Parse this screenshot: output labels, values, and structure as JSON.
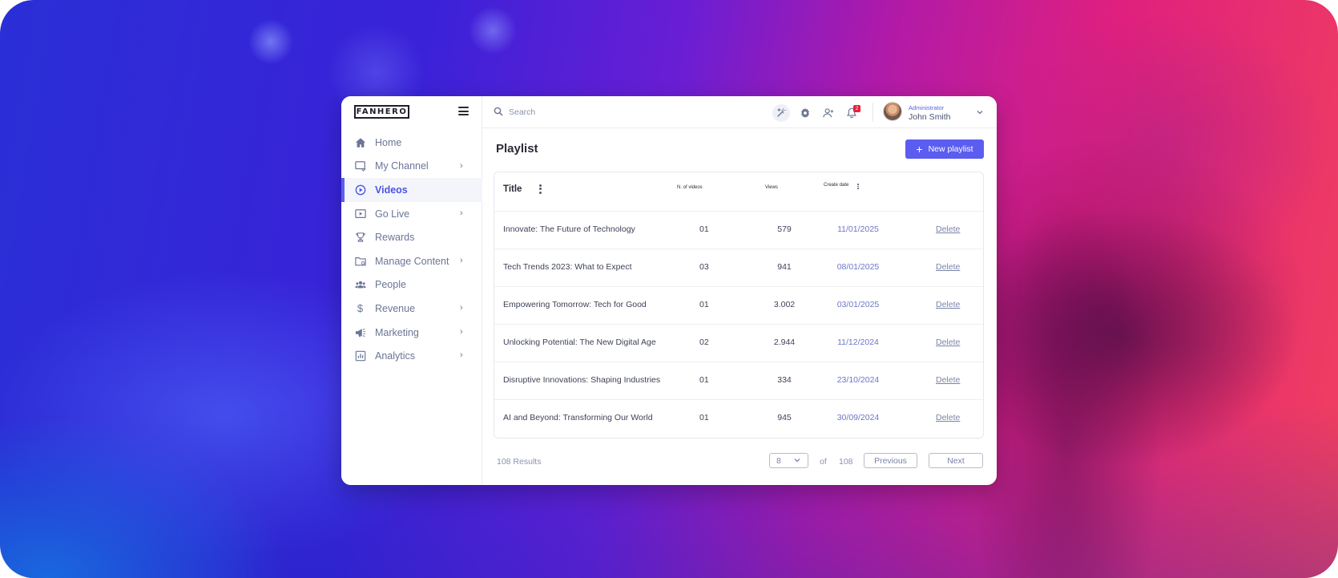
{
  "brand": {
    "logo_text": "FANHERO"
  },
  "sidebar": {
    "items": [
      {
        "label": "Home",
        "icon": "home-icon",
        "has_chevron": false,
        "active": false
      },
      {
        "label": "My Channel",
        "icon": "channel-icon",
        "has_chevron": true,
        "active": false
      },
      {
        "label": "Videos",
        "icon": "play-circle-icon",
        "has_chevron": false,
        "active": true
      },
      {
        "label": "Go Live",
        "icon": "live-icon",
        "has_chevron": true,
        "active": false
      },
      {
        "label": "Rewards",
        "icon": "trophy-icon",
        "has_chevron": false,
        "active": false
      },
      {
        "label": "Manage Content",
        "icon": "folder-icon",
        "has_chevron": true,
        "active": false
      },
      {
        "label": "People",
        "icon": "people-icon",
        "has_chevron": false,
        "active": false
      },
      {
        "label": "Revenue",
        "icon": "dollar-icon",
        "has_chevron": true,
        "active": false
      },
      {
        "label": "Marketing",
        "icon": "megaphone-icon",
        "has_chevron": true,
        "active": false
      },
      {
        "label": "Analytics",
        "icon": "analytics-icon",
        "has_chevron": true,
        "active": false
      }
    ]
  },
  "topbar": {
    "search_placeholder": "Search",
    "notification_count": "2",
    "user": {
      "role": "Administrator",
      "name": "John Smith"
    }
  },
  "main": {
    "title": "Playlist",
    "new_button": "New playlist",
    "table": {
      "headers": {
        "title": "Title",
        "videos": "N. of videos",
        "views": "Views",
        "date": "Create date"
      },
      "rows": [
        {
          "title": "Innovate: The Future of Technology",
          "videos": "01",
          "views": "579",
          "date": "11/01/2025",
          "action": "Delete"
        },
        {
          "title": "Tech Trends 2023: What to Expect",
          "videos": "03",
          "views": "941",
          "date": "08/01/2025",
          "action": "Delete"
        },
        {
          "title": "Empowering Tomorrow: Tech for Good",
          "videos": "01",
          "views": "3.002",
          "date": "03/01/2025",
          "action": "Delete"
        },
        {
          "title": "Unlocking Potential: The New Digital Age",
          "videos": "02",
          "views": "2.944",
          "date": "11/12/2024",
          "action": "Delete"
        },
        {
          "title": "Disruptive Innovations: Shaping Industries",
          "videos": "01",
          "views": "334",
          "date": "23/10/2024",
          "action": "Delete"
        },
        {
          "title": "AI and Beyond: Transforming Our World",
          "videos": "01",
          "views": "945",
          "date": "30/09/2024",
          "action": "Delete"
        }
      ]
    },
    "pagination": {
      "results": "108 Results",
      "per_page": "8",
      "of_label": "of",
      "total": "108",
      "previous": "Previous",
      "next": "Next"
    }
  },
  "colors": {
    "accent": "#5b5df0",
    "active_nav": "#4b55e0",
    "badge": "#e8203a"
  }
}
